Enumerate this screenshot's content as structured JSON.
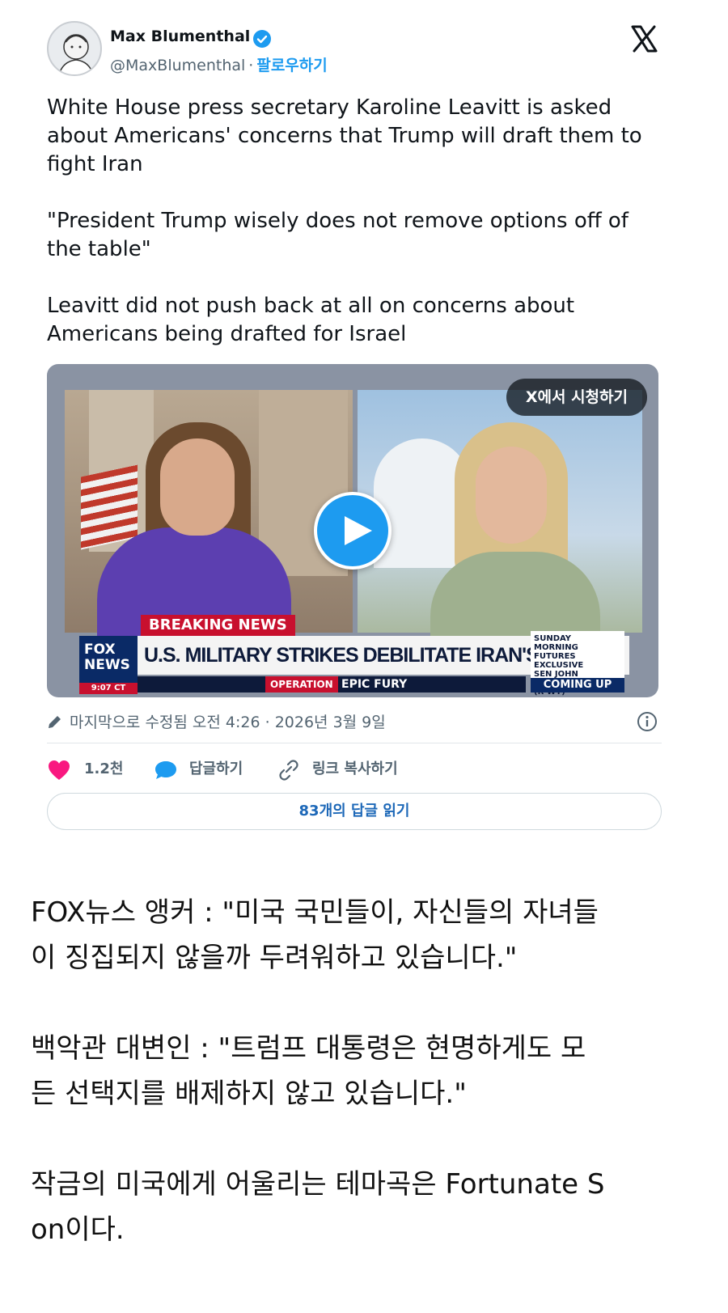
{
  "tweet": {
    "author_name": "Max Blumenthal",
    "handle": "@MaxBlumenthal",
    "separator": "·",
    "follow_label": "팔로우하기",
    "paragraphs": [
      "White House press secretary Karoline Leavitt is asked about Americans' concerns that Trump will draft them to fight Iran",
      "\"President Trump wisely does not remove options off of the table\"",
      "Leavitt did not push back at all on concerns about Americans being drafted for Israel"
    ],
    "video": {
      "watch_on_x_label": "X에서 시청하기",
      "breaking_label": "BREAKING NEWS",
      "headline": "U.S. MILITARY STRIKES DEBILITATE IRAN'S REGIME",
      "network_logo": "FOX NEWS",
      "time": "9:07 CT",
      "operation_label": "OPERATION",
      "operation_name": "EPIC FURY",
      "promo_text": "SUNDAY MORNING FUTURES EXCLUSIVE SEN JOHN BARRASSO (R-WY)",
      "coming_up_label": "COMING UP"
    },
    "edited_text": "마지막으로 수정됨 오전 4:26 · 2026년 3월 9일",
    "like_count": "1.2천",
    "reply_label": "답글하기",
    "copy_link_label": "링크 복사하기",
    "read_replies_label": "83개의 답글 읽기"
  },
  "post": {
    "paragraphs": [
      "FOX뉴스 앵커 : \"미국 국민들이, 자신들의 자녀들\n이 징집되지 않을까 두려워하고 있습니다.\"",
      "백악관 대변인 : \"트럼프 대통령은 현명하게도 모\n든 선택지를 배제하지 않고 있습니다.\"",
      "작금의 미국에게 어울리는 테마곡은 Fortunate S\non이다."
    ]
  },
  "colors": {
    "accent_blue": "#1d9bf0",
    "like_pink": "#f91880",
    "fox_red": "#c8102e",
    "fox_navy": "#0a2a66"
  },
  "icons": [
    "verified-badge-icon",
    "x-logo-icon",
    "play-icon",
    "pencil-icon",
    "info-icon",
    "heart-icon",
    "reply-bubble-icon",
    "link-icon"
  ]
}
